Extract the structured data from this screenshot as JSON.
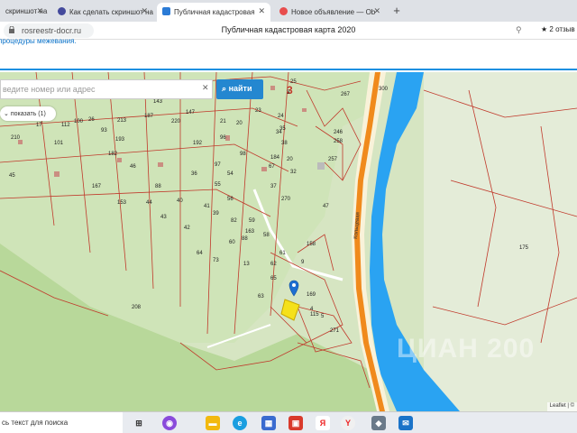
{
  "browser": {
    "tabs": [
      {
        "label": "скриншот на",
        "color": "#1a73e8"
      },
      {
        "label": "Как сделать скриншот на",
        "color": "#444a9c"
      },
      {
        "label": "Публичная кадастровая",
        "color": "#2b7bd6"
      },
      {
        "label": "Новое объявление — Ob",
        "color": "#e84d4d"
      }
    ],
    "url": "rosreestr-docr.ru",
    "page_title": "Публичная кадастровая карта 2020",
    "reviews": "2 отзыв"
  },
  "banner": {
    "text": "процедуры межевания."
  },
  "map": {
    "search_placeholder": "ведите номер или адрес",
    "search_clear": "✕",
    "search_button": "найти",
    "show_label": "показать (1)",
    "attribution": "Leaflet | ©",
    "watermark": "ЦИАН 200",
    "road_name": "Кольцевая",
    "labels": [
      "3",
      "300",
      "267",
      "25",
      "246",
      "258",
      "257",
      "143",
      "187",
      "213",
      "220",
      "26",
      "147",
      "21",
      "20",
      "23",
      "24",
      "34",
      "38",
      "35",
      "17",
      "210",
      "112",
      "100",
      "93",
      "192",
      "96",
      "98",
      "184",
      "67",
      "36",
      "54",
      "193",
      "101",
      "153",
      "182",
      "46",
      "45",
      "97",
      "37",
      "270",
      "32",
      "20",
      "167",
      "88",
      "44",
      "43",
      "42",
      "41",
      "40",
      "55",
      "56",
      "39",
      "82",
      "88",
      "163",
      "60",
      "59",
      "58",
      "13",
      "73",
      "64",
      "62",
      "61",
      "9",
      "47",
      "158",
      "65",
      "63",
      "169",
      "4",
      "208",
      "175",
      "5",
      "115",
      "271"
    ],
    "marker_icon": "map-marker-icon"
  },
  "taskbar": {
    "search_text": "сь текст для поиска",
    "icons": [
      "task-view-icon",
      "alice-icon",
      "explorer-icon",
      "edge-icon",
      "store-icon",
      "gallery-icon",
      "yandex-icon",
      "yandex-browser-icon",
      "photos-icon",
      "mail-icon"
    ]
  }
}
